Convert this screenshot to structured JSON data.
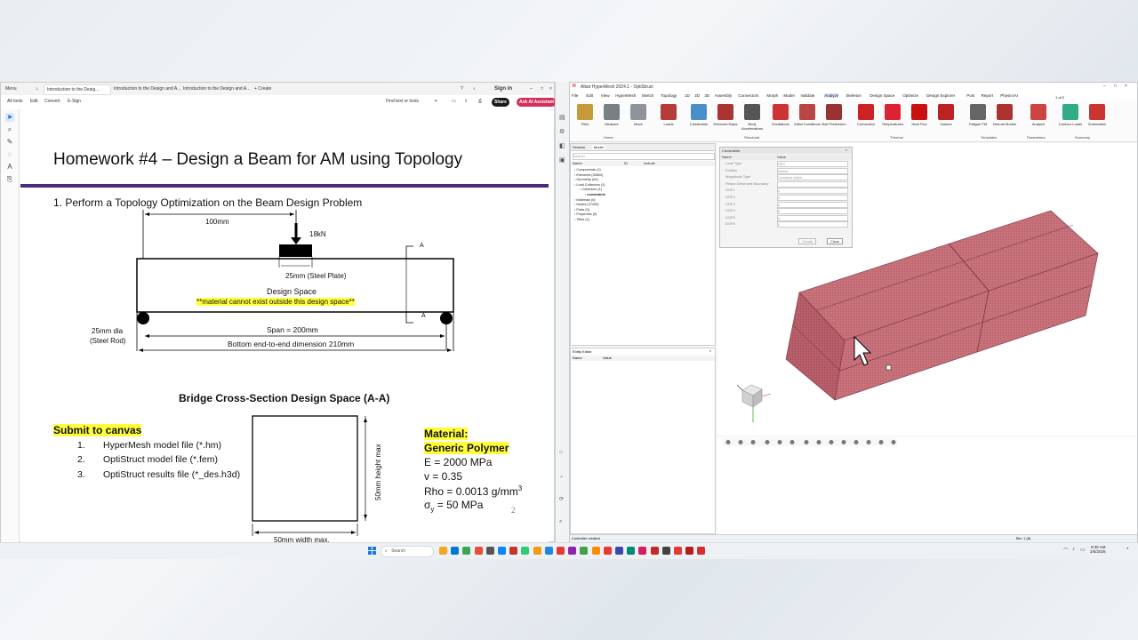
{
  "pdf": {
    "tabs": [
      "Menu",
      "Introduction to the Desig...",
      "Introduction to the Design and A...",
      "Introduction to the Design and A...",
      "+ Create"
    ],
    "sign_in": "Sign in",
    "menus": [
      "All tools",
      "Edit",
      "Convert",
      "E-Sign"
    ],
    "find_text": "Find text or tools",
    "share": "Share",
    "ask_ai": "Ask AI Assistant",
    "slide": {
      "title": "Homework #4 – Design a Beam for AM using Topology",
      "step1": "1. Perform a Topology Optimization on the Beam Design Problem",
      "dim_100mm": "100mm",
      "load_18kn": "18kN",
      "label_a_top": "A",
      "label_a_bottom": "A",
      "steel_plate": "25mm  (Steel Plate)",
      "design_space": "Design Space",
      "material_note": "**material cannot exist outside this design space**",
      "rod_dia": "25mm dia",
      "rod_name": "(Steel Rod)",
      "span": "Span = 200mm",
      "bottom_dim": "Bottom end-to-end dimension 210mm",
      "cross_section_title": "Bridge Cross-Section Design Space (A-A)",
      "submit_title": "Submit to canvas",
      "submit_items": [
        {
          "num": "1.",
          "text": "HyperMesh model file (*.hm)"
        },
        {
          "num": "2.",
          "text": "OptiStruct model file (*.fem)"
        },
        {
          "num": "3.",
          "text": "OptiStruct results file (*_des.h3d)"
        }
      ],
      "height_label": "50mm height max",
      "width_label": "50mm width max.",
      "material_title": "Material:",
      "material_name": "Generic Polymer",
      "prop_e": "E = 2000 MPa",
      "prop_v": "v = 0.35",
      "prop_rho": "Rho = 0.0013 g/mm",
      "prop_rho_sup": "3",
      "prop_sigma": "σ",
      "prop_sigma_sub": "y",
      "prop_sigma_val": " = 50 MPa",
      "page_num": "2"
    }
  },
  "hm": {
    "title": "Altair HyperMesh 2024.1 - OptiStruct",
    "menus": [
      "File",
      "Edit",
      "View",
      "HyperMesh",
      "Sketch",
      "Topology",
      "1D",
      "2D",
      "3D",
      "Assembly",
      "Connectors",
      "Morph",
      "Model",
      "Validate",
      "Analyze",
      "Skeleton",
      "Design Space",
      "Optimize",
      "Design Explorer",
      "Post",
      "Report",
      "PhysicsAI"
    ],
    "ribbon": [
      {
        "label": "Files",
        "color": "#c79b3a"
      },
      {
        "label": "Measure",
        "color": "#7a7f86"
      },
      {
        "label": "Move",
        "color": "#8f949b"
      },
      {
        "label": "Loads",
        "color": "#b23b3b"
      },
      {
        "label": "Constraints",
        "color": "#4a8fc7"
      },
      {
        "label": "Enforced Disps",
        "color": "#a33"
      },
      {
        "label": "Body Accelerations",
        "color": "#555"
      },
      {
        "label": "Excitations",
        "color": "#c33"
      },
      {
        "label": "Initial Conditions",
        "color": "#b44"
      },
      {
        "label": "Bolt Pretension",
        "color": "#933"
      },
      {
        "label": "Convection",
        "color": "#c22"
      },
      {
        "label": "Temperatures",
        "color": "#d23"
      },
      {
        "label": "Heat Flux",
        "color": "#c11"
      },
      {
        "label": "Volume",
        "color": "#b22"
      },
      {
        "label": "Fatigue FM",
        "color": "#666"
      },
      {
        "label": "Normal Modes",
        "color": "#a33"
      },
      {
        "label": "Analyze",
        "color": "#c44"
      },
      {
        "label": "Contour Loads",
        "color": "#3a8"
      },
      {
        "label": "Summation",
        "color": "#c33"
      }
    ],
    "groups": [
      "Home",
      "Structural",
      "Thermal",
      "Templates",
      "Parameters",
      "Summary"
    ],
    "model_tabs": [
      "Session",
      "Model"
    ],
    "search_placeholder": "Search",
    "tree_header": [
      "Name",
      "ID",
      "Include"
    ],
    "tree": [
      "Components (1)",
      "Elements (33600)",
      "Geometry (61)",
      "Load Collectors (1)",
      "Collectors (1)",
      "constraints",
      "Materials (0)",
      "Nodes (37425)",
      "Parts (0)",
      "Properties (0)",
      "Titles (1)"
    ],
    "entity_editor": "Entity Editor",
    "entity_cols": [
      "Name",
      "Value"
    ],
    "dialog": {
      "title": "Constraints",
      "cols": [
        "Name",
        "Value"
      ],
      "rows": [
        {
          "name": "Load Type",
          "value": "SPC"
        },
        {
          "name": "Entities",
          "value": "Nodes"
        },
        {
          "name": "Magnitude Type",
          "value": "Constant Value"
        },
        {
          "name": "Retain Deformed Boundary",
          "value": ""
        },
        {
          "name": "DOF1",
          "value": "0"
        },
        {
          "name": "DOF2",
          "value": "0"
        },
        {
          "name": "DOF3",
          "value": "0"
        },
        {
          "name": "DOF4",
          "value": "0"
        },
        {
          "name": "DOF5",
          "value": "0"
        },
        {
          "name": "DOF6",
          "value": "0"
        }
      ],
      "create": "Create",
      "close": "Close"
    },
    "status_left": "Controller created",
    "status_right": "Bin: 1 (8)",
    "right_top": "1 of 2"
  },
  "taskbar": {
    "search": "Search",
    "time": "9:35 AM",
    "date": "2/5/2026"
  },
  "colors": {
    "mesh": "#c9737c",
    "mesh_dark": "#a85560",
    "highlight": "#ffff3a",
    "accent_bar": "#4b2a7a"
  }
}
